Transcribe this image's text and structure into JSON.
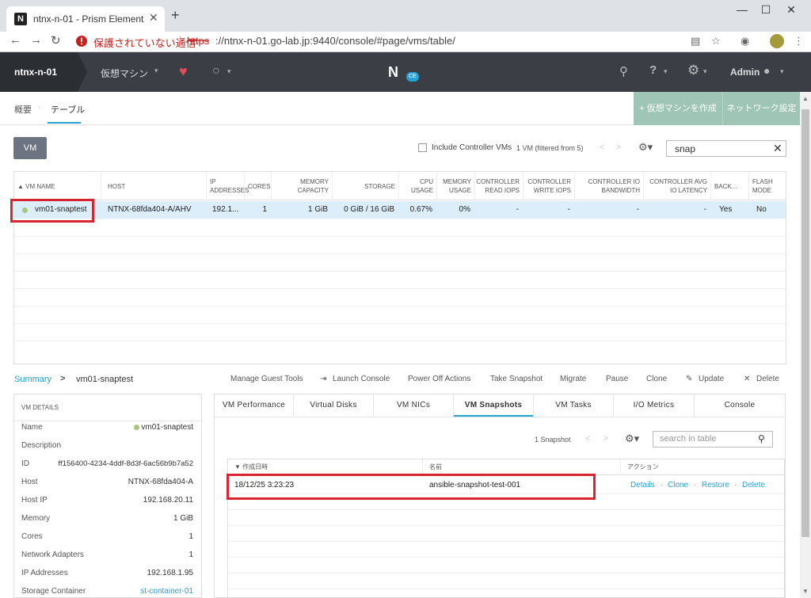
{
  "browser": {
    "tab_title": "ntnx-n-01 - Prism Element",
    "tab_favicon": "N",
    "not_secure": "保護されていない通信",
    "url_scheme": "https",
    "url_rest": "://ntnx-n-01.go-lab.jp:9440/console/#page/vms/table/"
  },
  "header": {
    "cluster": "ntnx-n-01",
    "nav_vm": "仮想マシン",
    "logo": "N",
    "logo_badge": "CE",
    "admin": "Admin"
  },
  "subnav": {
    "summary": "概要",
    "separator": "·",
    "table": "テーブル",
    "create_vm": "+  仮想マシンを作成",
    "network": "ネットワーク設定"
  },
  "toolbar": {
    "vm_button": "VM",
    "include_controller": "Include Controller VMs",
    "vm_count": "1 VM (filtered from 5)",
    "filter_value": "snap"
  },
  "vm_table": {
    "headers": [
      "▲  VM NAME",
      "HOST",
      "IP ADDRESSES",
      "CORES",
      "MEMORY CAPACITY",
      "STORAGE",
      "CPU USAGE",
      "MEMORY USAGE",
      "CONTROLLER READ IOPS",
      "CONTROLLER WRITE IOPS",
      "CONTROLLER IO BANDWIDTH",
      "CONTROLLER AVG IO LATENCY",
      "BACK...",
      "FLASH MODE"
    ],
    "row": [
      "vm01-snaptest",
      "NTNX-68fda404-A/AHV",
      "192.1...",
      "1",
      "1 GiB",
      "0 GiB / 16 GiB",
      "0.67%",
      "0%",
      "-",
      "-",
      "-",
      "-",
      "Yes",
      "No"
    ]
  },
  "actions": {
    "breadcrumb_summary": "Summary",
    "breadcrumb_vm": "vm01-snaptest",
    "manage_guest_tools": "Manage Guest Tools",
    "launch_console": "Launch Console",
    "power_off": "Power Off Actions",
    "take_snapshot": "Take Snapshot",
    "migrate": "Migrate",
    "pause": "Pause",
    "clone": "Clone",
    "update": "Update",
    "delete": "Delete"
  },
  "details": {
    "title": "VM DETAILS",
    "rows": [
      {
        "label": "Name",
        "value": "vm01-snaptest"
      },
      {
        "label": "Description",
        "value": ""
      },
      {
        "label": "ID",
        "value": "ff156400-4234-4ddf-8d3f-6ac56b9b7a52"
      },
      {
        "label": "Host",
        "value": "NTNX-68fda404-A"
      },
      {
        "label": "Host IP",
        "value": "192.168.20.11"
      },
      {
        "label": "Memory",
        "value": "1 GiB"
      },
      {
        "label": "Cores",
        "value": "1"
      },
      {
        "label": "Network Adapters",
        "value": "1"
      },
      {
        "label": "IP Addresses",
        "value": "192.168.1.95"
      },
      {
        "label": "Storage Container",
        "value": "st-container-01"
      }
    ]
  },
  "panel_tabs": [
    "VM Performance",
    "Virtual Disks",
    "VM NICs",
    "VM Snapshots",
    "VM Tasks",
    "I/O Metrics",
    "Console"
  ],
  "snapshots": {
    "count": "1 Snapshot",
    "search_placeholder": "search in table",
    "headers": [
      "▼  作成日時",
      "名前",
      "アクション"
    ],
    "row": {
      "created": "18/12/25 3:23:23",
      "name": "ansible-snapshot-test-001",
      "details": "Details",
      "clone": "Clone",
      "restore": "Restore",
      "delete": "Delete",
      "sep": "·"
    }
  },
  "colors": {
    "accent": "#26a1d6",
    "header": "#3b3f45",
    "create_button": "#9fc5b6",
    "highlight": "#d9232f",
    "status_on": "#a8c77a"
  }
}
